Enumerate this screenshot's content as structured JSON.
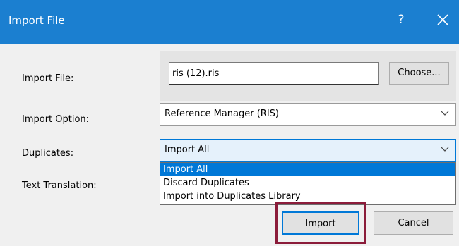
{
  "window": {
    "title": "Import File",
    "help": "?"
  },
  "form": {
    "import_file_label": "Import File:",
    "import_option_label": "Import Option:",
    "duplicates_label": "Duplicates:",
    "text_translation_label": "Text Translation:"
  },
  "file_input": {
    "value": "ris (12).ris"
  },
  "choose_button": "Choose...",
  "import_option": {
    "selected": "Reference Manager (RIS)"
  },
  "duplicates": {
    "selected": "Import All",
    "options": [
      "Import All",
      "Discard Duplicates",
      "Import into Duplicates Library"
    ]
  },
  "buttons": {
    "import": "Import",
    "cancel": "Cancel"
  },
  "colors": {
    "titlebar": "#1b7fd0",
    "selection": "#0078d7",
    "highlight": "#8b1c3a"
  }
}
